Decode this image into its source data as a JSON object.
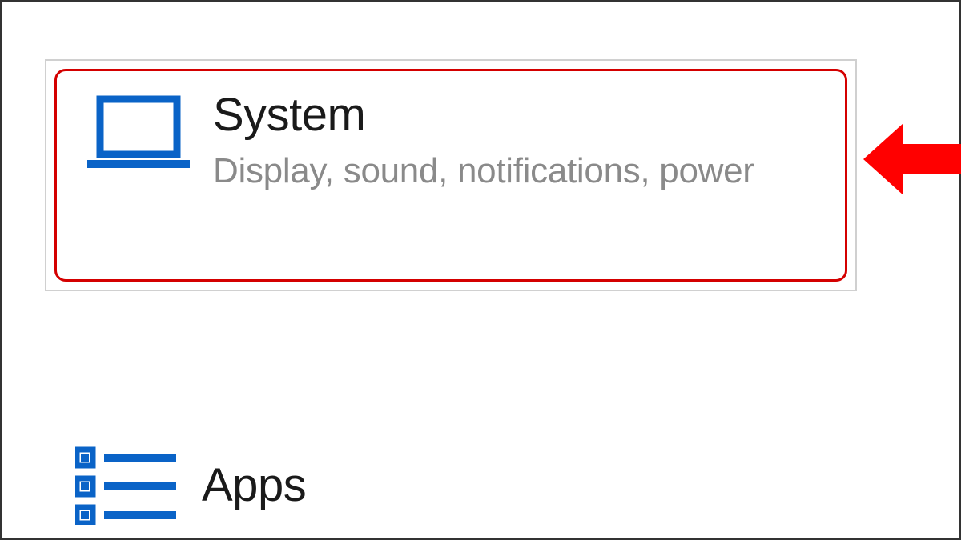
{
  "colors": {
    "accent": "#0a63c7",
    "highlight": "#d40000",
    "annotation": "#ff0000",
    "text_primary": "#1a1a1a",
    "text_secondary": "#8a8a8a"
  },
  "settings": {
    "system": {
      "title": "System",
      "subtitle": "Display, sound, notifications, power",
      "icon": "laptop-icon"
    },
    "apps": {
      "title": "Apps",
      "icon": "list-icon"
    }
  }
}
